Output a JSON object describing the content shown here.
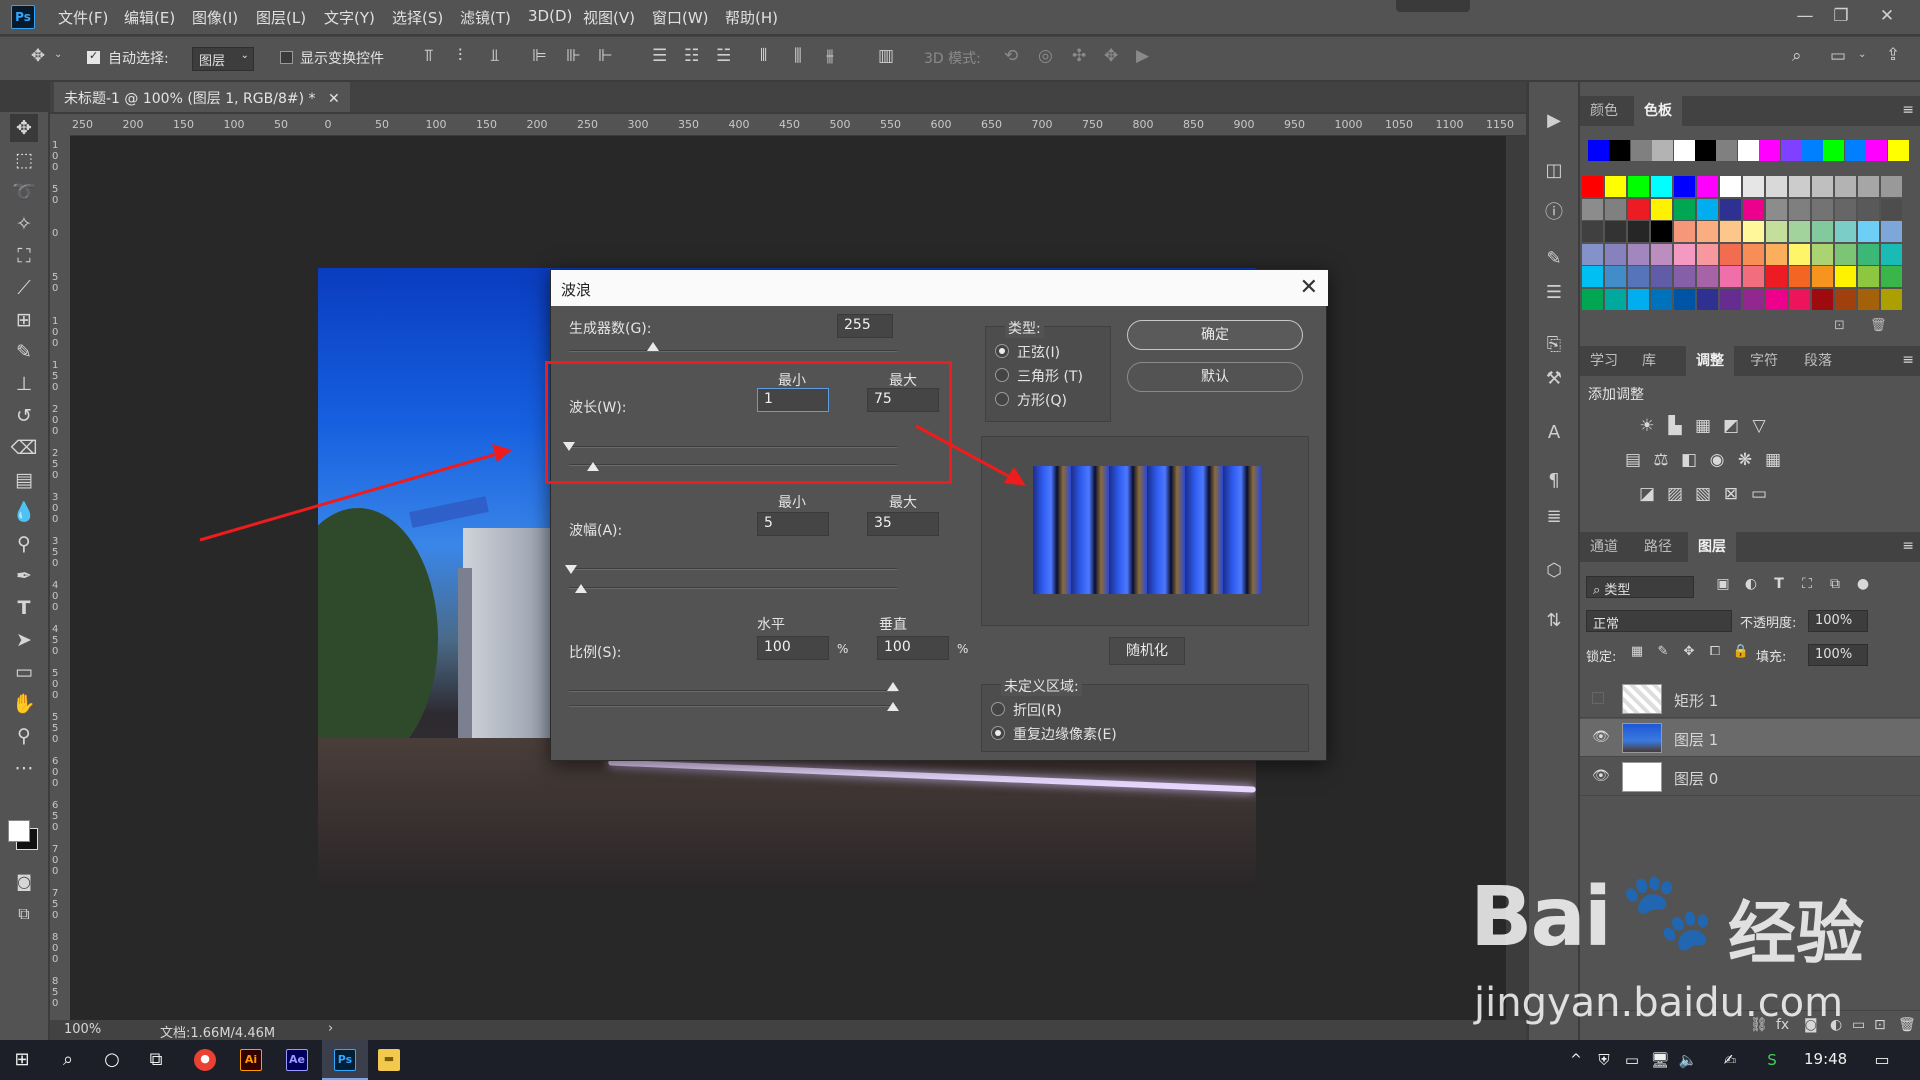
{
  "app": {
    "logo": "Ps",
    "menus": [
      "文件(F)",
      "编辑(E)",
      "图像(I)",
      "图层(L)",
      "文字(Y)",
      "选择(S)",
      "滤镜(T)",
      "3D(D)",
      "视图(V)",
      "窗口(W)",
      "帮助(H)"
    ],
    "window_buttons": [
      "—",
      "❐",
      "✕"
    ]
  },
  "options": {
    "auto_select_label": "自动选择:",
    "auto_select_value": "图层",
    "show_transform_label": "显示变换控件",
    "mode_3d_label": "3D 模式:"
  },
  "document": {
    "tab_title": "未标题-1 @ 100% (图层 1, RGB/8#) *",
    "ruler_top": [
      "250",
      "200",
      "150",
      "100",
      "50",
      "0",
      "50",
      "100",
      "150",
      "200",
      "250",
      "300",
      "350",
      "400",
      "450",
      "500",
      "550",
      "600",
      "650",
      "700",
      "750",
      "800",
      "850",
      "900",
      "950",
      "1000",
      "1050",
      "1100",
      "1150"
    ],
    "ruler_left": [
      "100",
      "50",
      "0",
      "50",
      "100",
      "150",
      "200",
      "250",
      "300",
      "350",
      "400",
      "450",
      "500",
      "550",
      "600",
      "650",
      "700",
      "750",
      "800",
      "850"
    ],
    "zoom": "100%",
    "doc_size": "文档:1.66M/4.46M"
  },
  "dialog": {
    "title": "波浪",
    "generators_label": "生成器数(G):",
    "generators_value": "255",
    "min_label": "最小",
    "max_label": "最大",
    "wavelength_label": "波长(W):",
    "wavelength_min": "1",
    "wavelength_max": "75",
    "amplitude_label": "波幅(A):",
    "amplitude_min": "5",
    "amplitude_max": "35",
    "horizontal_label": "水平",
    "vertical_label": "垂直",
    "scale_label": "比例(S):",
    "scale_h": "100",
    "scale_v": "100",
    "percent": "%",
    "type_label": "类型:",
    "type_options": [
      "正弦(I)",
      "三角形 (T)",
      "方形(Q)"
    ],
    "type_selected": "正弦(I)",
    "ok": "确定",
    "default": "默认",
    "randomize": "随机化",
    "undefined_label": "未定义区域:",
    "undefined_options": [
      "折回(R)",
      "重复边缘像素(E)"
    ],
    "undefined_selected": "重复边缘像素(E)"
  },
  "panels": {
    "swatch_tabs": [
      "颜色",
      "色板"
    ],
    "swatch_active": "色板",
    "swatch_top_row": [
      "#0000ff",
      "#000000",
      "#808080",
      "#b3b3b3",
      "#ffffff",
      "#000000",
      "#808080",
      "#ffffff",
      "#ff00ff",
      "#8040ff",
      "#0080ff",
      "#00ff00",
      "#0080ff",
      "#ff00ff",
      "#ffff00"
    ],
    "swatch_grid": [
      [
        "#ff0000",
        "#ffff00",
        "#00ff00",
        "#00ffff",
        "#0000ff",
        "#ff00ff",
        "#ffffff",
        "#e6e6e6",
        "#d9d9d9",
        "#cccccc",
        "#bfbfbf",
        "#b3b3b3",
        "#a6a6a6",
        "#999999"
      ],
      [
        "#8c8c8c",
        "#808080",
        "#ed1c24",
        "#fff200",
        "#00a651",
        "#00aeef",
        "#2e3192",
        "#ec008c",
        "#8c8c8c",
        "#7f7f7f",
        "#737373",
        "#666666",
        "#595959",
        "#4d4d4d"
      ],
      [
        "#404040",
        "#333333",
        "#262626",
        "#000000",
        "#f7977a",
        "#f9ad81",
        "#fdc68a",
        "#fff79a",
        "#c4df9b",
        "#a3d39c",
        "#82ca9d",
        "#7bcdc8",
        "#6dcff6",
        "#7da7d9"
      ],
      [
        "#8393ca",
        "#8781bd",
        "#a187be",
        "#bc8dbf",
        "#f49ac2",
        "#f6989d",
        "#f26c4f",
        "#f68e55",
        "#fbaf5d",
        "#fff568",
        "#acd372",
        "#7cc576",
        "#3bb878",
        "#1abbb4"
      ],
      [
        "#00bff3",
        "#438cca",
        "#5574b9",
        "#605ca8",
        "#855fa8",
        "#a763a8",
        "#f06ea9",
        "#f26d7d",
        "#ed1c24",
        "#f26522",
        "#f7941d",
        "#fff200",
        "#8dc63f",
        "#39b54a"
      ],
      [
        "#00a651",
        "#00a99d",
        "#00aeef",
        "#0072bc",
        "#0054a6",
        "#2e3192",
        "#662d91",
        "#92278f",
        "#ec008c",
        "#ed145b",
        "#9e0b0f",
        "#a0410d",
        "#a36209",
        "#aba000"
      ]
    ],
    "adj_tabs": [
      "学习",
      "库",
      "调整",
      "字符",
      "段落"
    ],
    "adj_active": "调整",
    "add_adjustment": "添加调整",
    "layer_tabs": [
      "通道",
      "路径",
      "图层"
    ],
    "layer_active": "图层",
    "kind_filter": "类型",
    "blend_mode": "正常",
    "opacity_label": "不透明度:",
    "opacity_value": "100%",
    "lock_label": "锁定:",
    "fill_label": "填充:",
    "fill_value": "100%",
    "layers": [
      {
        "name": "矩形 1",
        "visible": false
      },
      {
        "name": "图层 1",
        "visible": true
      },
      {
        "name": "图层 0",
        "visible": true
      }
    ]
  },
  "taskbar": {
    "time": "19:48"
  },
  "watermark": {
    "brand": "Bai",
    "brand_cn": "经验",
    "url": "jingyan.baidu.com"
  }
}
